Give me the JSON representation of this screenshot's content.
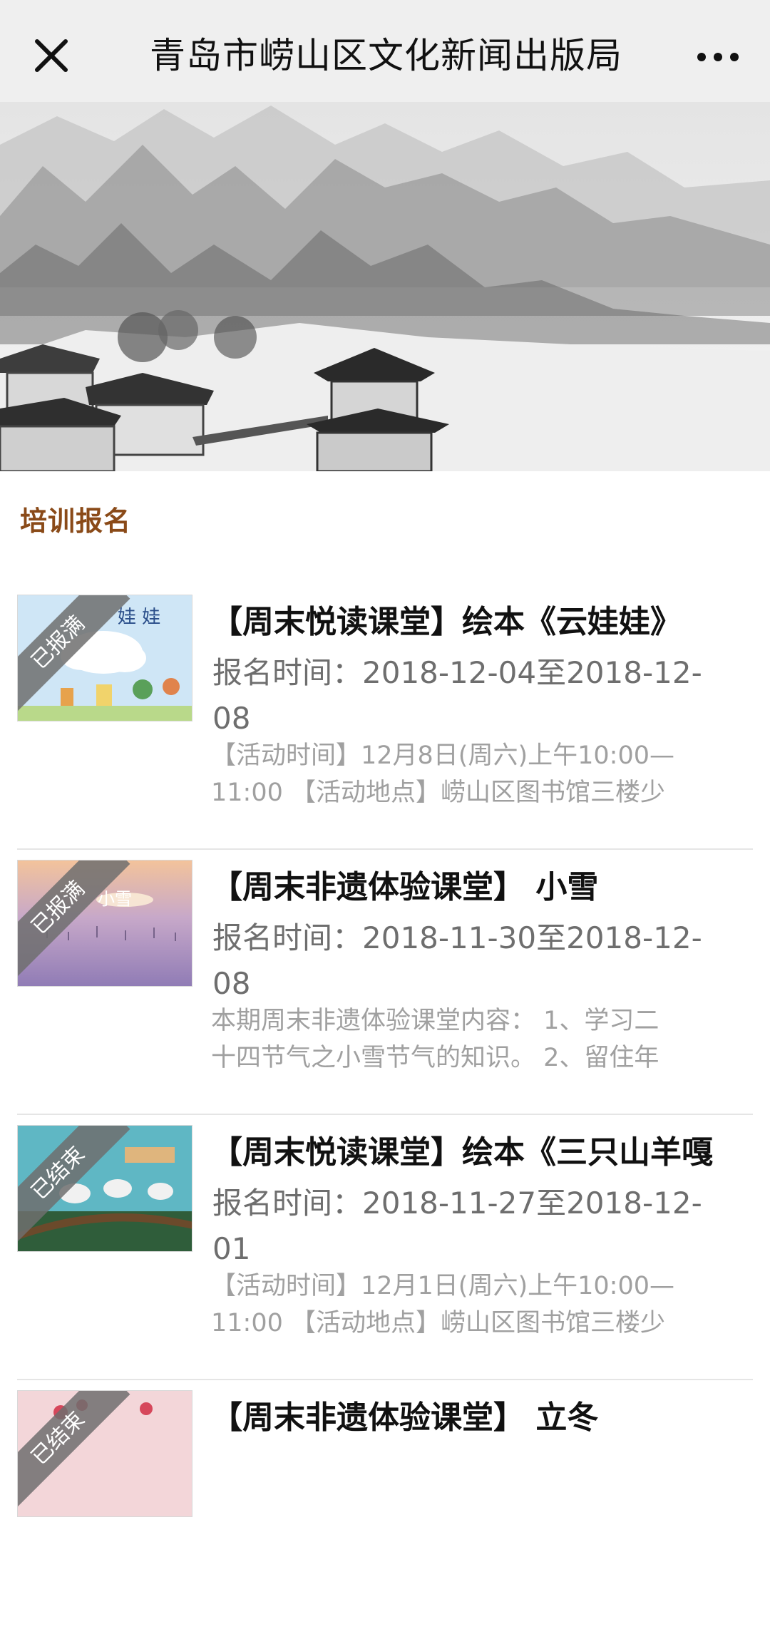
{
  "header": {
    "title": "青岛市崂山区文化新闻出版局",
    "close_icon": "close-icon",
    "more_icon": "more-icon"
  },
  "section": {
    "title": "培训报名"
  },
  "items": [
    {
      "title": "【周末悦读课堂】绘本《云娃娃》",
      "time_line1": "报名时间：2018-12-04至2018-12-",
      "time_line2": "08",
      "desc_line1": "【活动时间】12月8日(周六)上午10:00—",
      "desc_line2": "11:00 【活动地点】崂山区图书馆三楼少",
      "status": "已报满",
      "thumb_text": "娃 娃"
    },
    {
      "title": "【周末非遗体验课堂】 小雪",
      "time_line1": "报名时间：2018-11-30至2018-12-",
      "time_line2": "08",
      "desc_line1": "本期周末非遗体验课堂内容： 1、学习二",
      "desc_line2": "十四节气之小雪节气的知识。 2、留住年",
      "status": "已报满",
      "thumb_text": "小雪"
    },
    {
      "title": "【周末悦读课堂】绘本《三只山羊嘎",
      "time_line1": "报名时间：2018-11-27至2018-12-",
      "time_line2": "01",
      "desc_line1": "【活动时间】12月1日(周六)上午10:00—",
      "desc_line2": "11:00 【活动地点】崂山区图书馆三楼少",
      "status": "已结束",
      "thumb_text": ""
    },
    {
      "title": "【周末非遗体验课堂】 立冬",
      "status": "已结束"
    }
  ],
  "colors": {
    "section_title": "#8a4a18",
    "ribbon": "#6e6e6e",
    "time_text": "#6e6e6e",
    "desc_text": "#a0a0a0"
  }
}
